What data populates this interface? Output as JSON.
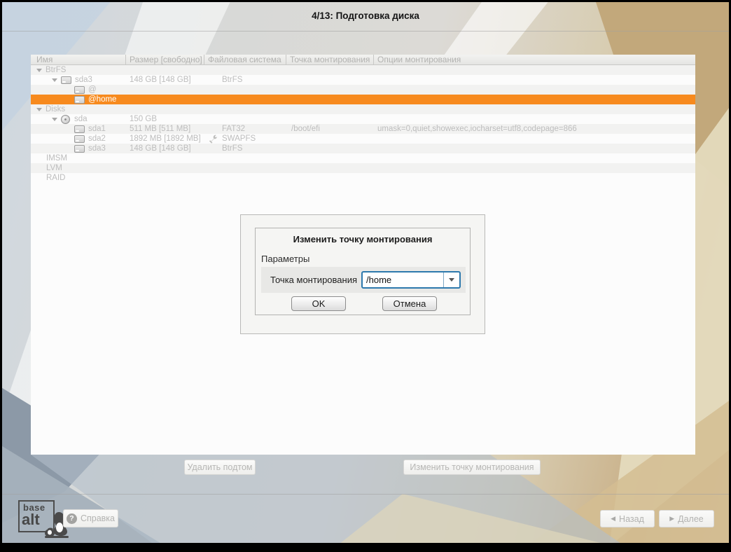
{
  "window": {
    "title": "4/13: Подготовка диска"
  },
  "colors": {
    "selection_orange": "#f78a1e",
    "focus_blue": "#2d79ad"
  },
  "table": {
    "columns": [
      "Имя",
      "Размер [свободно]",
      "Файловая система",
      "Точка монтирования",
      "Опции монтирования"
    ],
    "rows": [
      {
        "name": "BtrFS"
      },
      {
        "name": "sda3",
        "size": "148 GB [148 GB]",
        "fs": "BtrFS"
      },
      {
        "name": "@"
      },
      {
        "name": "@home",
        "selected": true
      },
      {
        "name": "Disks"
      },
      {
        "name": "sda",
        "size": "150 GB"
      },
      {
        "name": "sda1",
        "size": "511 MB [511 MB]",
        "fs": "FAT32",
        "mount": "/boot/efi",
        "options": "umask=0,quiet,showexec,iocharset=utf8,codepage=866"
      },
      {
        "name": "sda2",
        "size": "1892 MB [1892 MB]",
        "fs": "SWAPFS"
      },
      {
        "name": "sda3",
        "size": "148 GB [148 GB]",
        "fs": "BtrFS"
      },
      {
        "name": "IMSM"
      },
      {
        "name": "LVM"
      },
      {
        "name": "RAID"
      }
    ]
  },
  "dialog": {
    "title": "Изменить точку монтирования",
    "section": "Параметры",
    "field_label": "Точка монтирования",
    "field_value": "/home",
    "ok_label": "OK",
    "cancel_label": "Отмена"
  },
  "actions": {
    "delete_subvolume": "Удалить подтом",
    "change_mountpoint": "Изменить точку монтирования"
  },
  "footer": {
    "help_label": "Справка",
    "help_icon_glyph": "?",
    "back_label": "Назад",
    "next_label": "Далее",
    "back_arrow": "◀",
    "next_arrow": "▶",
    "logo_line1": "base",
    "logo_line2": "alt"
  }
}
